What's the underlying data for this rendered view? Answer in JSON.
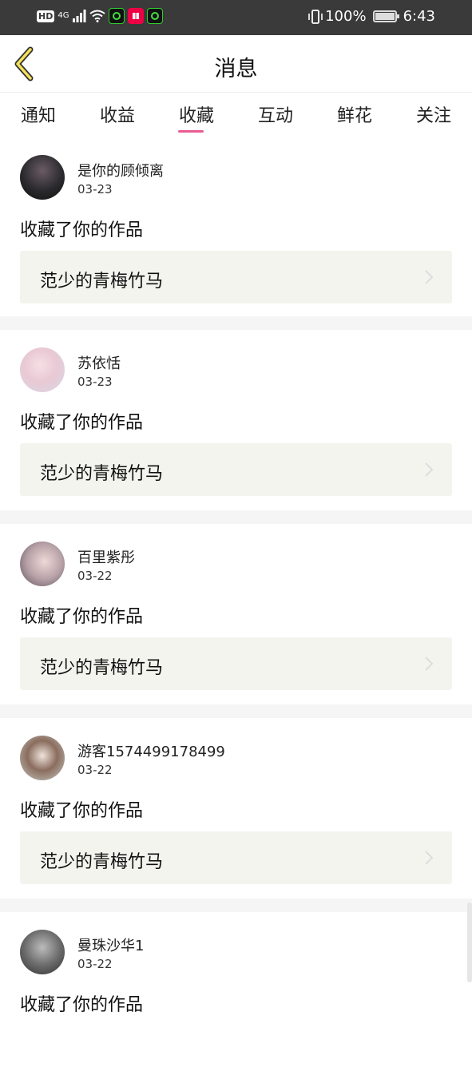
{
  "status_bar": {
    "hd": "HD",
    "network": "4G",
    "battery": "100%",
    "time": "6:43",
    "battery_level": 1.0
  },
  "header": {
    "title": "消息"
  },
  "tabs": [
    {
      "label": "通知",
      "active": false
    },
    {
      "label": "收益",
      "active": false
    },
    {
      "label": "收藏",
      "active": true
    },
    {
      "label": "互动",
      "active": false
    },
    {
      "label": "鲜花",
      "active": false
    },
    {
      "label": "关注",
      "active": false
    }
  ],
  "accent_color": "#e85b93",
  "notifications": [
    {
      "user": "是你的顾倾离",
      "date": "03-23",
      "action": "收藏了你的作品",
      "work": "范少的青梅竹马"
    },
    {
      "user": "苏依恬",
      "date": "03-23",
      "action": "收藏了你的作品",
      "work": "范少的青梅竹马"
    },
    {
      "user": "百里紫彤",
      "date": "03-22",
      "action": "收藏了你的作品",
      "work": "范少的青梅竹马"
    },
    {
      "user": "游客1574499178499",
      "date": "03-22",
      "action": "收藏了你的作品",
      "work": "范少的青梅竹马"
    },
    {
      "user": "曼珠沙华1",
      "date": "03-22",
      "action": "收藏了你的作品",
      "work": ""
    }
  ]
}
